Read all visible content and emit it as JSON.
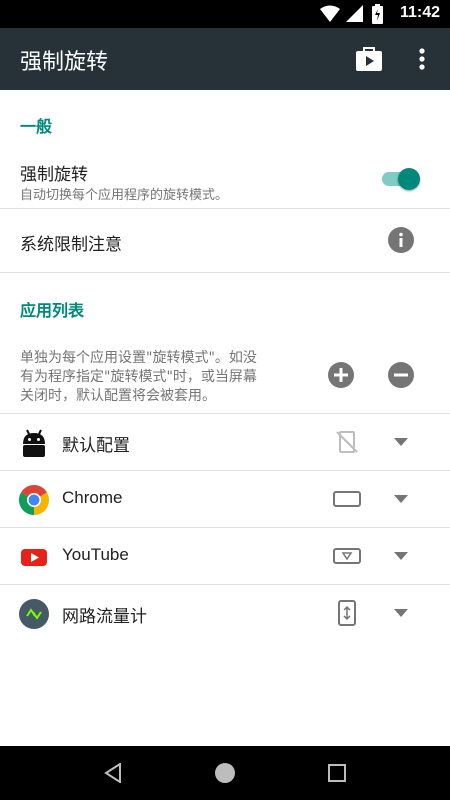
{
  "status_bar": {
    "time": "11:42",
    "icons": [
      "wifi-icon",
      "signal-icon",
      "battery-icon"
    ]
  },
  "app_bar": {
    "title": "强制旋转",
    "actions": [
      "store-icon",
      "more-vert-icon"
    ]
  },
  "general": {
    "header": "一般",
    "force_rotation": {
      "title": "强制旋转",
      "subtitle": "自动切换每个应用程序的旋转模式。",
      "enabled": true
    },
    "system_limits": {
      "title": "系统限制注意",
      "icon": "info-icon"
    }
  },
  "app_list": {
    "header": "应用列表",
    "description_lines": [
      "单独为每个应用设置\"旋转模式\"。如没",
      "有为程序指定\"旋转模式\"时，或当屏幕",
      "关闭时，默认配置将会被套用。"
    ],
    "add_icon": "add-icon",
    "remove_icon": "remove-icon",
    "items": [
      {
        "name": "默认配置",
        "icon": "android-icon",
        "mode_icon": "rotation-off-icon"
      },
      {
        "name": "Chrome",
        "icon": "chrome-icon",
        "mode_icon": "landscape-icon"
      },
      {
        "name": "YouTube",
        "icon": "youtube-icon",
        "mode_icon": "reverse-landscape-icon"
      },
      {
        "name": "网路流量计",
        "icon": "traffic-meter-icon",
        "mode_icon": "portrait-icon"
      }
    ]
  },
  "nav_bar": {
    "buttons": [
      "back-icon",
      "home-icon",
      "recents-icon"
    ]
  },
  "colors": {
    "accent": "#00897b",
    "toolbar": "#263238",
    "toggle_track": "#80cbc4"
  }
}
